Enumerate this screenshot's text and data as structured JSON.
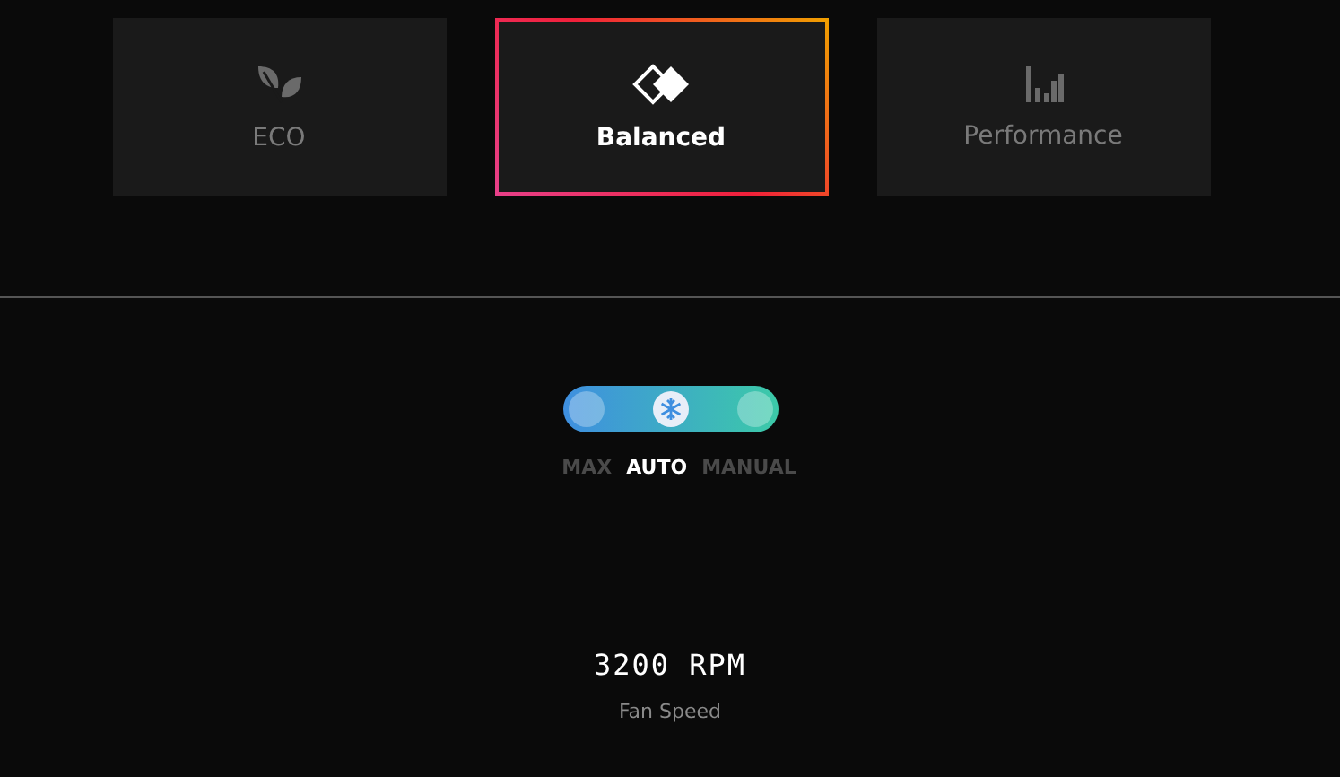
{
  "modes": [
    {
      "kind": "leaf",
      "label": "ECO",
      "selected": false
    },
    {
      "kind": "diamond",
      "label": "Balanced",
      "selected": true
    },
    {
      "kind": "bars",
      "label": "Performance",
      "selected": false
    }
  ],
  "fan_modes": [
    {
      "label": "MAX",
      "selected": false
    },
    {
      "label": "AUTO",
      "selected": true
    },
    {
      "label": "MANUAL",
      "selected": false
    }
  ],
  "fan_speed": {
    "value": "3200 RPM",
    "label": "Fan Speed"
  }
}
